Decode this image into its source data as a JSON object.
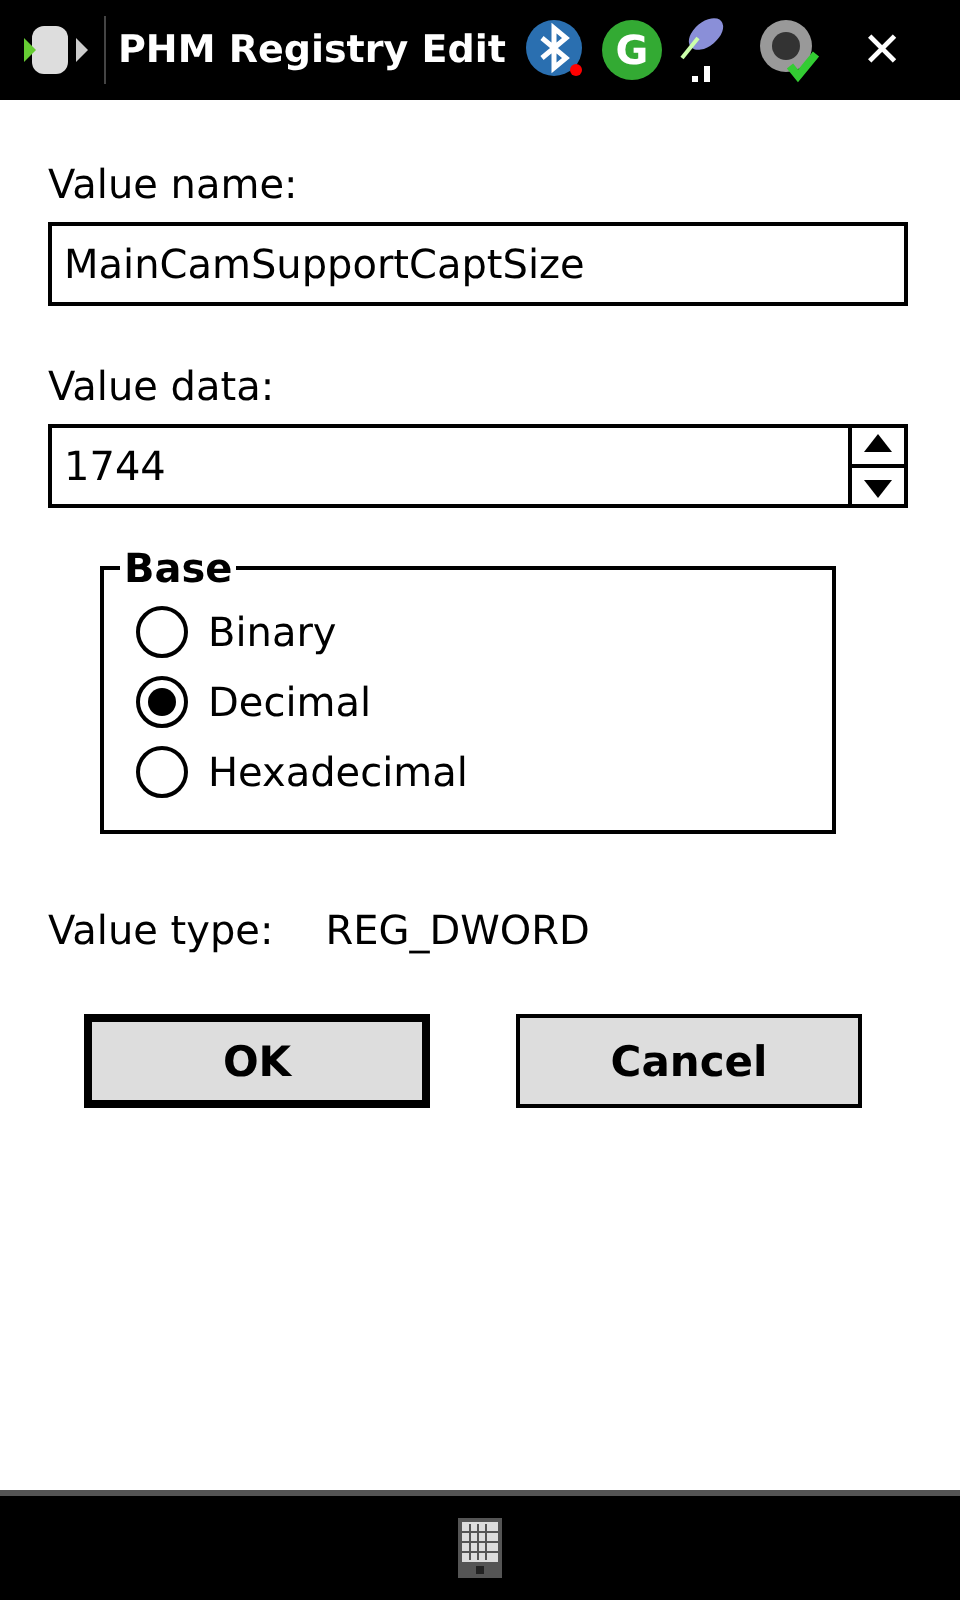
{
  "title_bar": {
    "title": "PHM Registry Edit",
    "g_icon_letter": "G",
    "close": "✕"
  },
  "value_name": {
    "label": "Value name:",
    "value": "MainCamSupportCaptSize"
  },
  "value_data": {
    "label": "Value data:",
    "value": "1744"
  },
  "base": {
    "legend": "Base",
    "options": [
      {
        "label": "Binary",
        "selected": false
      },
      {
        "label": "Decimal",
        "selected": true
      },
      {
        "label": "Hexadecimal",
        "selected": false
      }
    ]
  },
  "value_type": {
    "label": "Value type:",
    "value": "REG_DWORD"
  },
  "buttons": [
    {
      "label": "OK",
      "default": true
    },
    {
      "label": "Cancel",
      "default": false
    }
  ]
}
